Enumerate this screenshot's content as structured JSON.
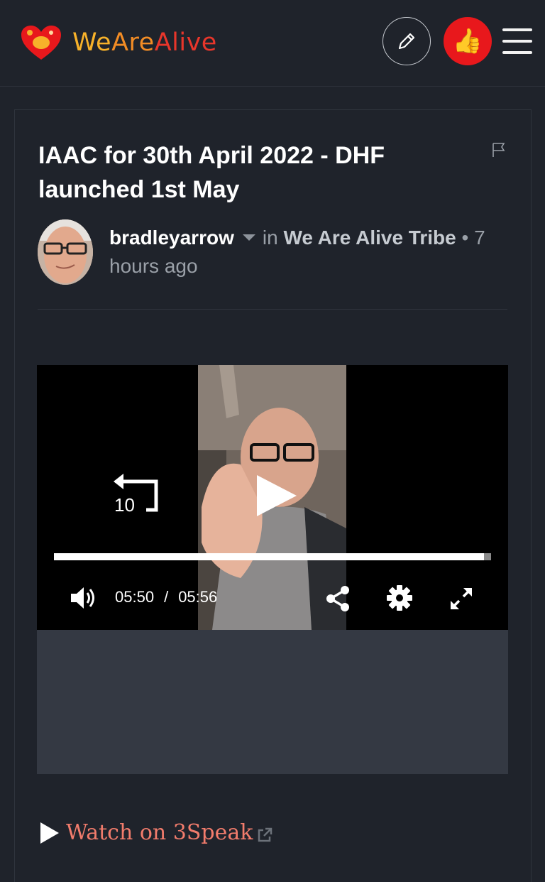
{
  "header": {
    "logo_parts": [
      "We",
      "Are",
      "Alive"
    ],
    "logo_icon": "heart-emblem-icon",
    "edit_icon": "pencil-icon",
    "avatar_emoji": "👍",
    "menu_icon": "hamburger-menu-icon"
  },
  "post": {
    "title": "IAAC for 30th April 2022 - DHF launched 1st May",
    "author": "bradleyarrow",
    "in_label": "in",
    "community": "We Are Alive Tribe",
    "bullet": "•",
    "time_ago": "7 hours ago"
  },
  "video": {
    "rewind_label": "10",
    "current_time": "05:50",
    "separator": "/",
    "duration": "05:56",
    "progress": 0.983
  },
  "watch": {
    "label": "Watch on 3Speak"
  },
  "colors": {
    "background": "#1f232b",
    "link": "#f27c6c",
    "avatar_bg": "#e8181c"
  }
}
